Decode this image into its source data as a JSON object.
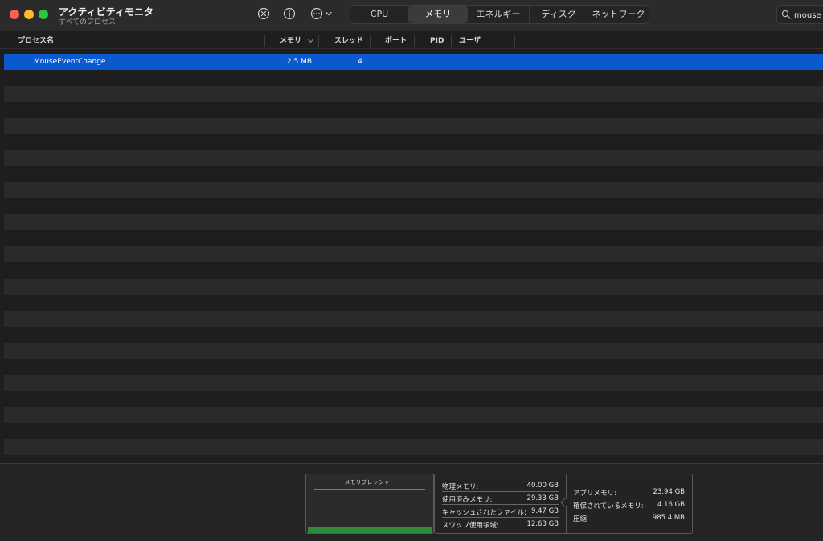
{
  "window": {
    "title": "アクティビティモニタ",
    "subtitle": "すべてのプロセス"
  },
  "toolbar": {
    "icons": [
      "stop-process-icon",
      "info-icon",
      "more-actions-icon"
    ],
    "tabs": [
      {
        "label": "CPU",
        "active": false
      },
      {
        "label": "メモリ",
        "active": true
      },
      {
        "label": "エネルギー",
        "active": false
      },
      {
        "label": "ディスク",
        "active": false
      },
      {
        "label": "ネットワーク",
        "active": false
      }
    ]
  },
  "search": {
    "value": "mouse"
  },
  "table": {
    "columns": {
      "name": "プロセス名",
      "memory": "メモリ",
      "threads": "スレッド",
      "ports": "ポート",
      "pid": "PID",
      "user": "ユーザ"
    },
    "sort_column": "memory",
    "sort_direction": "descending",
    "rows": [
      {
        "name": "MouseEventChange",
        "memory": "2.5 MB",
        "threads": "4",
        "ports": "",
        "pid": "",
        "user": "",
        "selected": true
      }
    ]
  },
  "memory_pressure": {
    "title": "メモリプレッシャー",
    "color": "#2f8b3b"
  },
  "stats_left": [
    {
      "label": "物理メモリ:",
      "value": "40.00 GB"
    },
    {
      "label": "使用済みメモリ:",
      "value": "29.33 GB"
    },
    {
      "label": "キャッシュされたファイル:",
      "value": "9.47 GB"
    },
    {
      "label": "スワップ使用領域:",
      "value": "12.63 GB"
    }
  ],
  "stats_right": [
    {
      "label": "アプリメモリ:",
      "value": "23.94 GB"
    },
    {
      "label": "確保されているメモリ:",
      "value": "4.16 GB"
    },
    {
      "label": "圧縮:",
      "value": "985.4 MB"
    }
  ],
  "colors": {
    "selection": "#0a59cf",
    "close": "#ff5f57",
    "minimize": "#febc2e",
    "zoom": "#28c840"
  }
}
